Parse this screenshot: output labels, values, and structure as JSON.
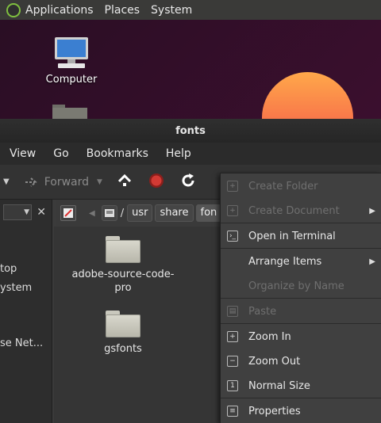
{
  "panel": {
    "menus": [
      "Applications",
      "Places",
      "System"
    ]
  },
  "desktop": {
    "icons": [
      {
        "label": "Computer",
        "icon": "computer-icon"
      },
      {
        "label": "",
        "icon": "folder-icon"
      }
    ]
  },
  "window": {
    "title": "fonts",
    "menus": [
      "View",
      "Go",
      "Bookmarks",
      "Help"
    ],
    "toolbar": {
      "forward_label": "Forward"
    },
    "path_crumbs": [
      "/",
      "usr",
      "share",
      "fon"
    ],
    "sidebar_items": [
      "top",
      "ystem",
      "se Net..."
    ],
    "files": [
      {
        "name": "adobe-source-code-pro",
        "name_lines": [
          "adobe-source-code-",
          "pro"
        ]
      },
      {
        "name": "gsfonts",
        "name_lines": [
          "gsfonts"
        ]
      }
    ]
  },
  "context_menu": {
    "items": [
      {
        "label": "Create Folder",
        "disabled": true,
        "icon": "new-folder-icon"
      },
      {
        "label": "Create Document",
        "disabled": true,
        "icon": "new-document-icon",
        "submenu": true
      },
      {
        "label": "Open in Terminal",
        "disabled": false,
        "icon": "terminal-icon"
      },
      {
        "label": "Arrange Items",
        "disabled": false,
        "submenu": true
      },
      {
        "label": "Organize by Name",
        "disabled": true
      },
      {
        "label": "Paste",
        "disabled": true,
        "icon": "paste-icon"
      },
      {
        "label": "Zoom In",
        "disabled": false,
        "icon": "zoom-in-icon"
      },
      {
        "label": "Zoom Out",
        "disabled": false,
        "icon": "zoom-out-icon"
      },
      {
        "label": "Normal Size",
        "disabled": false,
        "icon": "normal-size-icon"
      },
      {
        "label": "Properties",
        "disabled": false,
        "icon": "properties-icon"
      }
    ]
  },
  "colors": {
    "accent": "#7fbf3f",
    "stop": "#c0312e",
    "window_bg": "#3b3b3b",
    "desktop_bg": "#2b0f25"
  }
}
